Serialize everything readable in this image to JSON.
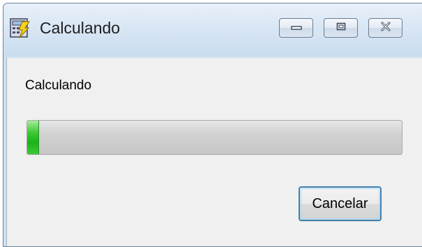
{
  "window": {
    "title": "Calculando",
    "icon": "calculator-lightning-icon",
    "caption_buttons": [
      "minimize-icon",
      "maximize-icon",
      "close-icon"
    ]
  },
  "dialog": {
    "status_text": "Calculando",
    "progress_percent": 3,
    "progress_color": "#1db51d",
    "cancel_label": "Cancelar"
  }
}
